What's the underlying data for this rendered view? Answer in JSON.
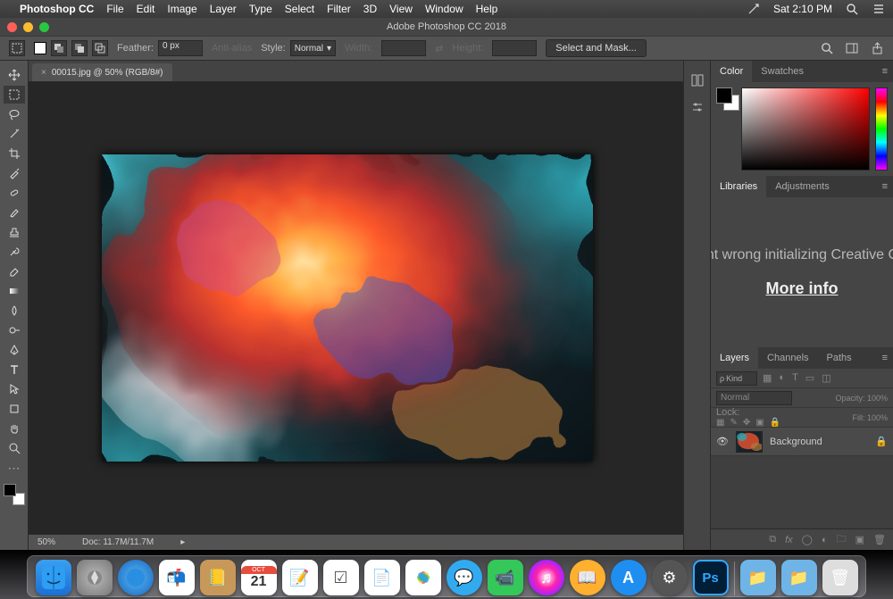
{
  "menubar": {
    "app": "Photoshop CC",
    "items": [
      "File",
      "Edit",
      "Image",
      "Layer",
      "Type",
      "Select",
      "Filter",
      "3D",
      "View",
      "Window",
      "Help"
    ],
    "clock": "Sat 2:10 PM"
  },
  "window": {
    "title": "Adobe Photoshop CC 2018"
  },
  "options": {
    "feather_label": "Feather:",
    "feather_value": "0 px",
    "antialias": "Anti-alias",
    "style_label": "Style:",
    "style_value": "Normal",
    "width_label": "Width:",
    "height_label": "Height:",
    "select_mask": "Select and Mask..."
  },
  "document": {
    "tab": "00015.jpg @ 50% (RGB/8#)",
    "zoom": "50%",
    "docsize": "Doc: 11.7M/11.7M"
  },
  "panels": {
    "color_tab": "Color",
    "swatches_tab": "Swatches",
    "libraries_tab": "Libraries",
    "adjustments_tab": "Adjustments",
    "lib_msg": "Something went wrong initializing Creative Cloud Libraries.",
    "lib_link": "More info",
    "layers_tab": "Layers",
    "channels_tab": "Channels",
    "paths_tab": "Paths",
    "kind": "Kind",
    "blend": "Normal",
    "opacity_label": "Opacity:",
    "opacity": "100%",
    "lock_label": "Lock:",
    "fill_label": "Fill:",
    "fill": "100%",
    "layer_name": "Background"
  },
  "tools": [
    "move",
    "marquee",
    "lasso",
    "wand",
    "crop",
    "eyedropper",
    "healing",
    "brush",
    "stamp",
    "history-brush",
    "eraser",
    "gradient",
    "blur",
    "dodge",
    "pen",
    "type",
    "path-select",
    "shape",
    "hand",
    "zoom"
  ],
  "dock": [
    "finder",
    "launchpad",
    "safari",
    "mail",
    "contacts",
    "calendar",
    "notes",
    "reminders",
    "pages",
    "photos",
    "messages",
    "facetime",
    "itunes",
    "ibooks",
    "appstore",
    "settings",
    "photoshop",
    "downloads",
    "documents",
    "trash"
  ]
}
